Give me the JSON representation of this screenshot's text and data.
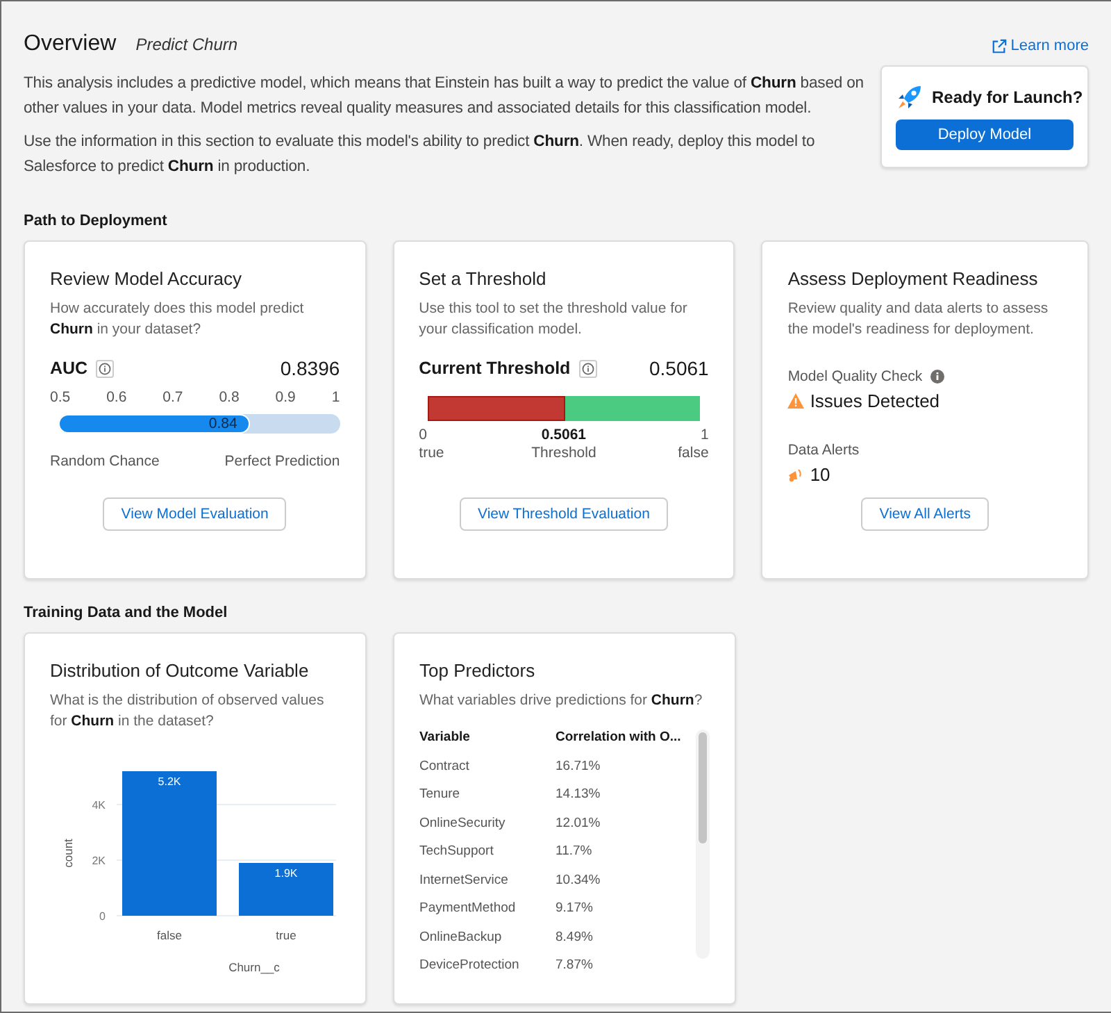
{
  "header": {
    "title": "Overview",
    "subtitle": "Predict Churn",
    "learn_more": "Learn more",
    "paragraphs": [
      "This analysis includes a predictive model, which means that Einstein has built a way to predict the value of **Churn** based on other values in your data. Model metrics reveal quality measures and associated details for this classification model.",
      "Use the information in this section to evaluate this model's ability to predict **Churn**. When ready, deploy this model to Salesforce to predict **Churn** in production."
    ]
  },
  "launch": {
    "title": "Ready for Launch?",
    "button": "Deploy Model"
  },
  "sections": [
    {
      "title": "Path to Deployment",
      "cards": [
        {
          "kind": "accuracy",
          "title": "Review Model Accuracy",
          "description": "How accurately does this model predict **Churn** in your dataset?",
          "metric_label": "AUC",
          "metric_value": "0.8396",
          "scale": [
            "0.5",
            "0.6",
            "0.7",
            "0.8",
            "0.9",
            "1"
          ],
          "level": 0.68,
          "bar_label": "0.84",
          "left_caption": "Random Chance",
          "right_caption": "Perfect Prediction",
          "button": "View Model Evaluation"
        },
        {
          "kind": "threshold",
          "title": "Set a Threshold",
          "description": "Use this tool to set the threshold value for your classification model.",
          "metric_label": "Current Threshold",
          "metric_value": "0.5061",
          "level": 0.5061,
          "min": "0",
          "min_caption": "true",
          "mid": "0.5061",
          "mid_caption": "Threshold",
          "max": "1",
          "max_caption": "false",
          "button": "View Threshold Evaluation"
        },
        {
          "kind": "readiness",
          "title": "Assess Deployment Readiness",
          "description": "Review quality and data alerts to assess the model's readiness for deployment.",
          "quality_label": "Model Quality Check",
          "quality_value": "Issues Detected",
          "alerts_label": "Data Alerts",
          "alerts_value": "10",
          "button": "View All Alerts"
        }
      ]
    },
    {
      "title": "Training Data and the Model",
      "cards": [
        {
          "kind": "distribution",
          "title": "Distribution of Outcome Variable",
          "description": "What is the distribution of observed values for **Churn** in the dataset?",
          "chart_data": {
            "type": "bar",
            "xlabel": "Churn__c",
            "ylabel": "count",
            "categories": [
              "false",
              "true"
            ],
            "series": [
              {
                "color": "#0b6fd6",
                "values": [
                  5200,
                  1900
                ]
              }
            ],
            "ylim": [
              0,
              5200
            ],
            "yticks": [
              {
                "value": 0,
                "label": "0"
              },
              {
                "value": 2000,
                "label": "2K"
              },
              {
                "value": 4000,
                "label": "4K"
              }
            ],
            "value_labels": [
              "5.2K",
              "1.9K"
            ]
          }
        },
        {
          "kind": "predictors",
          "title": "Top Predictors",
          "description": "What variables drive predictions for **Churn**?",
          "columns": [
            "Variable",
            "Correlation with O..."
          ],
          "rows": [
            [
              "Contract",
              "16.71%"
            ],
            [
              "Tenure",
              "14.13%"
            ],
            [
              "OnlineSecurity",
              "12.01%"
            ],
            [
              "TechSupport",
              "11.7%"
            ],
            [
              "InternetService",
              "10.34%"
            ],
            [
              "PaymentMethod",
              "9.17%"
            ],
            [
              "OnlineBackup",
              "8.49%"
            ],
            [
              "DeviceProtection",
              "7.87%"
            ]
          ]
        }
      ]
    }
  ]
}
